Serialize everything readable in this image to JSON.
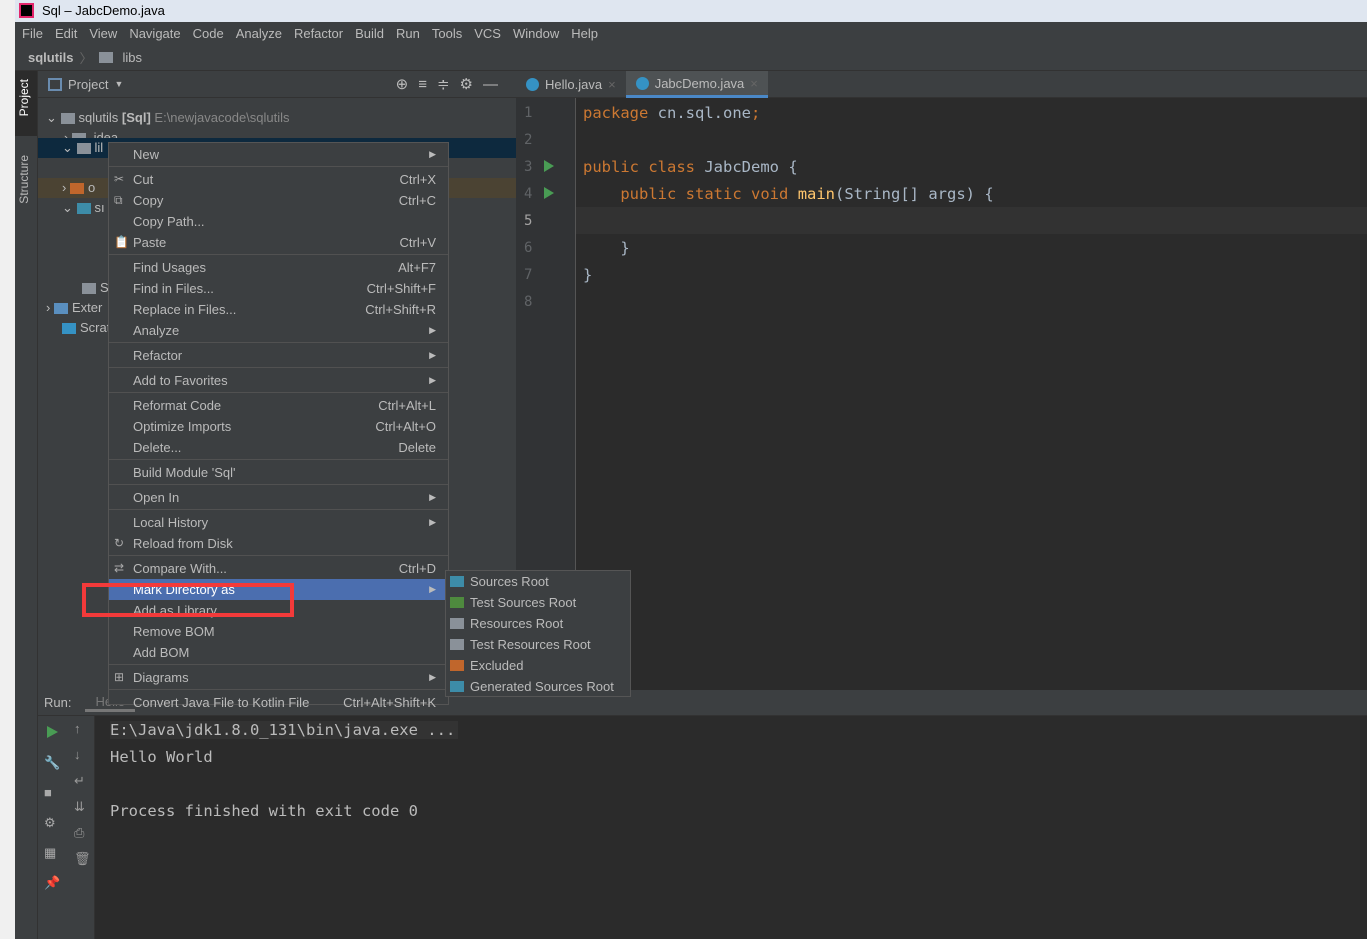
{
  "window": {
    "title": "Sql – JabcDemo.java"
  },
  "menubar": [
    "File",
    "Edit",
    "View",
    "Navigate",
    "Code",
    "Analyze",
    "Refactor",
    "Build",
    "Run",
    "Tools",
    "VCS",
    "Window",
    "Help"
  ],
  "breadcrumb": {
    "project": "sqlutils",
    "folder": "libs"
  },
  "toolwindows": {
    "project": "Project",
    "structure": "Structure"
  },
  "project_panel": {
    "title": "Project",
    "root_name": "sqlutils",
    "root_module": "[Sql]",
    "root_path": "E:\\newjavacode\\sqlutils",
    "rows": [
      ".idea",
      "lil",
      "",
      "o",
      "sı",
      "",
      "Sc",
      "Exter",
      "Scrat"
    ]
  },
  "tabs": [
    {
      "label": "Hello.java",
      "active": false
    },
    {
      "label": "JabcDemo.java",
      "active": true
    }
  ],
  "editor": {
    "lines": [
      "package cn.sql.one;",
      "",
      "public class JabcDemo {",
      "    public static void main(String[] args) {",
      "",
      "    }",
      "}",
      ""
    ],
    "current_line": 5
  },
  "run": {
    "label": "Run:",
    "tab": "Hello",
    "output": [
      "E:\\Java\\jdk1.8.0_131\\bin\\java.exe ...",
      "Hello World",
      "",
      "Process finished with exit code 0"
    ]
  },
  "context_menu": [
    {
      "label": "New",
      "submenu": true
    },
    {
      "sep": true
    },
    {
      "label": "Cut",
      "shortcut": "Ctrl+X",
      "icon": "scissors"
    },
    {
      "label": "Copy",
      "shortcut": "Ctrl+C",
      "icon": "copy"
    },
    {
      "label": "Copy Path..."
    },
    {
      "label": "Paste",
      "shortcut": "Ctrl+V",
      "icon": "clipboard"
    },
    {
      "sep": true
    },
    {
      "label": "Find Usages",
      "shortcut": "Alt+F7"
    },
    {
      "label": "Find in Files...",
      "shortcut": "Ctrl+Shift+F"
    },
    {
      "label": "Replace in Files...",
      "shortcut": "Ctrl+Shift+R"
    },
    {
      "label": "Analyze",
      "submenu": true
    },
    {
      "sep": true
    },
    {
      "label": "Refactor",
      "submenu": true
    },
    {
      "sep": true
    },
    {
      "label": "Add to Favorites",
      "submenu": true
    },
    {
      "sep": true
    },
    {
      "label": "Reformat Code",
      "shortcut": "Ctrl+Alt+L"
    },
    {
      "label": "Optimize Imports",
      "shortcut": "Ctrl+Alt+O"
    },
    {
      "label": "Delete...",
      "shortcut": "Delete"
    },
    {
      "sep": true
    },
    {
      "label": "Build Module 'Sql'"
    },
    {
      "sep": true
    },
    {
      "label": "Open In",
      "submenu": true
    },
    {
      "sep": true
    },
    {
      "label": "Local History",
      "submenu": true
    },
    {
      "label": "Reload from Disk",
      "icon": "reload"
    },
    {
      "sep": true
    },
    {
      "label": "Compare With...",
      "shortcut": "Ctrl+D",
      "icon": "compare"
    },
    {
      "label": "Mark Directory as",
      "submenu": true,
      "highlighted": true
    },
    {
      "label": "Add as Library..."
    },
    {
      "label": "Remove BOM"
    },
    {
      "label": "Add BOM"
    },
    {
      "sep": true
    },
    {
      "label": "Diagrams",
      "submenu": true,
      "icon": "diagram"
    },
    {
      "sep": true
    },
    {
      "label": "Convert Java File to Kotlin File",
      "shortcut": "Ctrl+Alt+Shift+K"
    }
  ],
  "submenu": [
    {
      "label": "Sources Root",
      "color": "#3d8ca8"
    },
    {
      "label": "Test Sources Root",
      "color": "#4e8a3e"
    },
    {
      "label": "Resources Root",
      "color": "#8a9199"
    },
    {
      "label": "Test Resources Root",
      "color": "#8a9199"
    },
    {
      "label": "Excluded",
      "color": "#c0662c"
    },
    {
      "label": "Generated Sources Root",
      "color": "#3d8ca8"
    }
  ],
  "highlight_box_color": "#f33a3a"
}
